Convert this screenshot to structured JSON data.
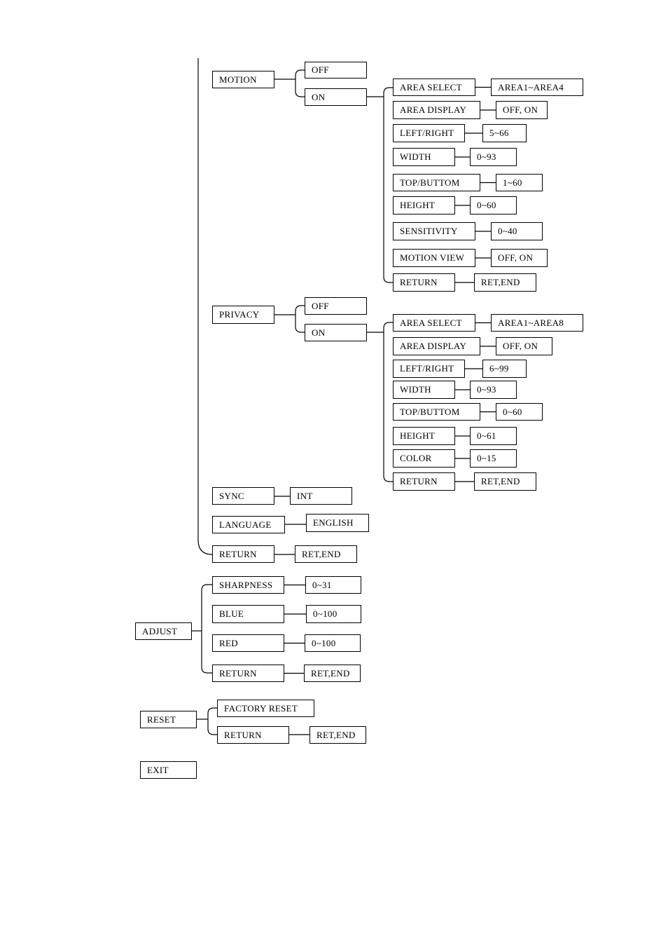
{
  "motion": {
    "label": "MOTION",
    "off": "OFF",
    "on": "ON",
    "items": [
      {
        "label": "AREA SELECT",
        "value": "AREA1~AREA4"
      },
      {
        "label": "AREA DISPLAY",
        "value": "OFF, ON"
      },
      {
        "label": "LEFT/RIGHT",
        "value": "5~66"
      },
      {
        "label": "WIDTH",
        "value": "0~93"
      },
      {
        "label": "TOP/BUTTOM",
        "value": "1~60"
      },
      {
        "label": "HEIGHT",
        "value": "0~60"
      },
      {
        "label": "SENSITIVITY",
        "value": "0~40"
      },
      {
        "label": "MOTION VIEW",
        "value": "OFF, ON"
      },
      {
        "label": "RETURN",
        "value": "RET,END"
      }
    ]
  },
  "privacy": {
    "label": "PRIVACY",
    "off": "OFF",
    "on": "ON",
    "items": [
      {
        "label": "AREA SELECT",
        "value": "AREA1~AREA8"
      },
      {
        "label": "AREA DISPLAY",
        "value": "OFF, ON"
      },
      {
        "label": "LEFT/RIGHT",
        "value": "6~99"
      },
      {
        "label": "WIDTH",
        "value": "0~93"
      },
      {
        "label": "TOP/BUTTOM",
        "value": "0~60"
      },
      {
        "label": "HEIGHT",
        "value": "0~61"
      },
      {
        "label": "COLOR",
        "value": "0~15"
      },
      {
        "label": "RETURN",
        "value": "RET,END"
      }
    ]
  },
  "sync": {
    "label": "SYNC",
    "value": "INT"
  },
  "language": {
    "label": "LANGUAGE",
    "value": "ENGLISH"
  },
  "setup_return": {
    "label": "RETURN",
    "value": "RET,END"
  },
  "adjust": {
    "label": "ADJUST",
    "items": [
      {
        "label": "SHARPNESS",
        "value": "0~31"
      },
      {
        "label": "BLUE",
        "value": "0~100"
      },
      {
        "label": "RED",
        "value": "0~100"
      },
      {
        "label": "RETURN",
        "value": "RET,END"
      }
    ]
  },
  "reset": {
    "label": "RESET",
    "factory_reset": "FACTORY RESET",
    "return": {
      "label": "RETURN",
      "value": "RET,END"
    }
  },
  "exit": {
    "label": "EXIT"
  }
}
